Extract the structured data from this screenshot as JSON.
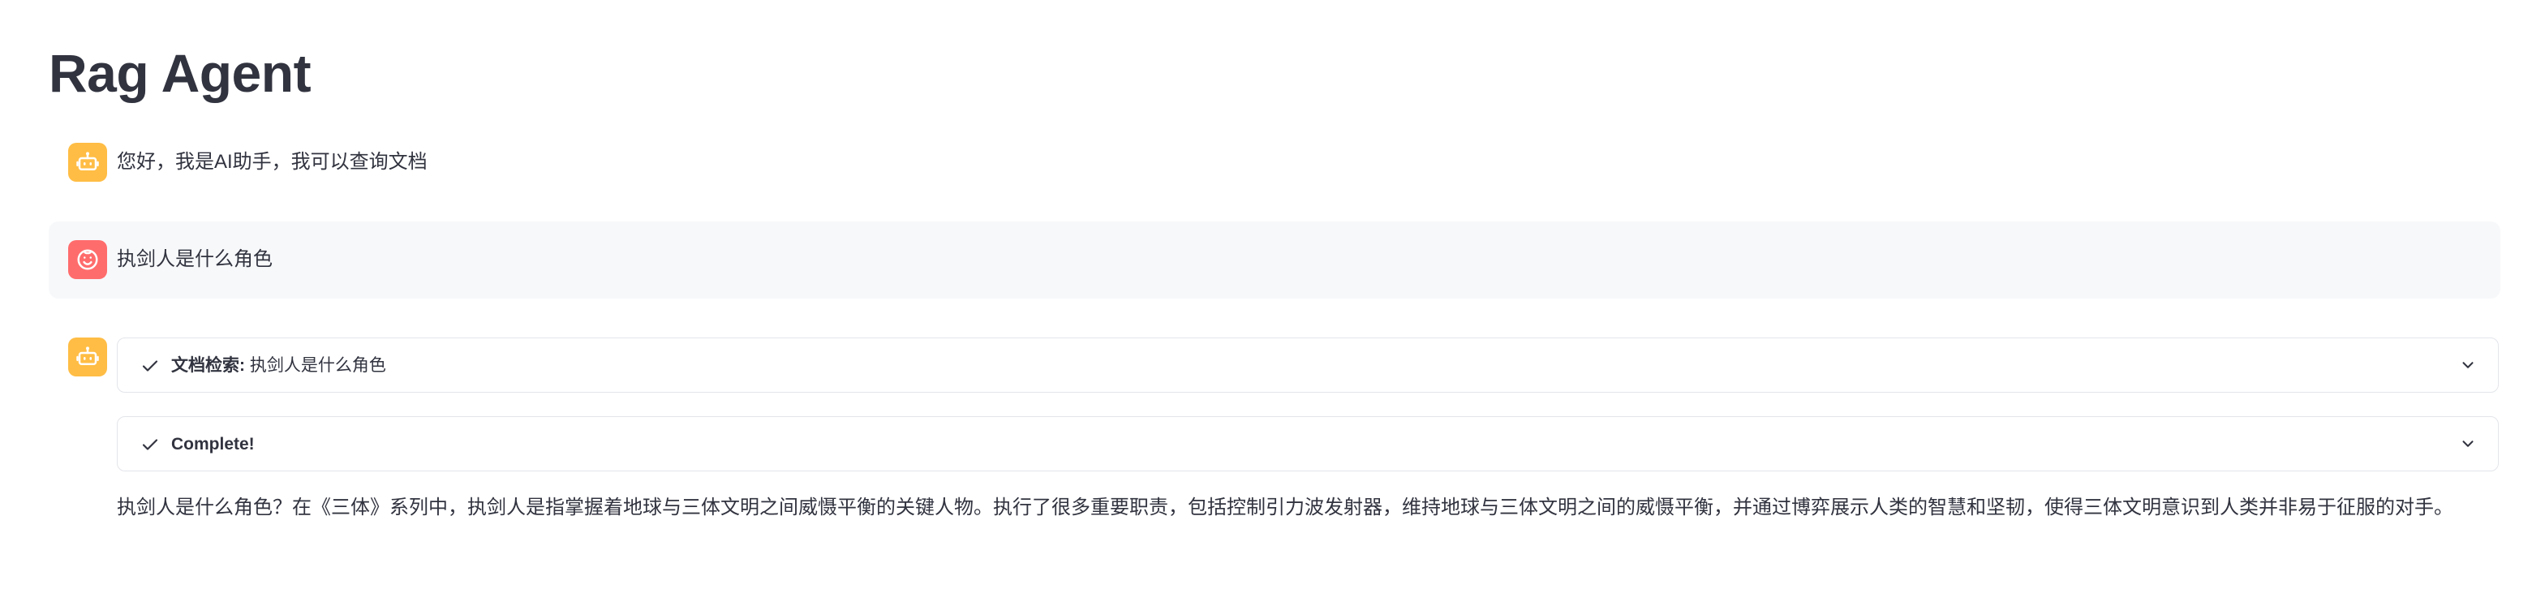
{
  "app": {
    "title": "Rag Agent"
  },
  "messages": [
    {
      "role": "assistant",
      "avatar_icon": "robot-icon",
      "text": "您好，我是AI助手，我可以查询文档"
    },
    {
      "role": "user",
      "avatar_icon": "face-icon",
      "text": "执剑人是什么角色"
    },
    {
      "role": "assistant",
      "avatar_icon": "robot-icon",
      "steps": [
        {
          "status_icon": "check-icon",
          "label_bold": "文档检索:",
          "label_rest": " 执剑人是什么角色",
          "toggle_icon": "chevron-down-icon"
        },
        {
          "status_icon": "check-icon",
          "label_bold": "Complete!",
          "label_rest": "",
          "toggle_icon": "chevron-down-icon"
        }
      ],
      "answer": "执剑人是什么角色？在《三体》系列中，执剑人是指掌握着地球与三体文明之间威慑平衡的关键人物。执行了很多重要职责，包括控制引力波发射器，维持地球与三体文明之间的威慑平衡，并通过博弈展示人类的智慧和坚韧，使得三体文明意识到人类并非易于征服的对手。"
    }
  ],
  "colors": {
    "bot_avatar": "#ffbd45",
    "user_avatar": "#ff6c6c",
    "user_row_bg": "#f7f8fa",
    "text": "#31333f"
  }
}
